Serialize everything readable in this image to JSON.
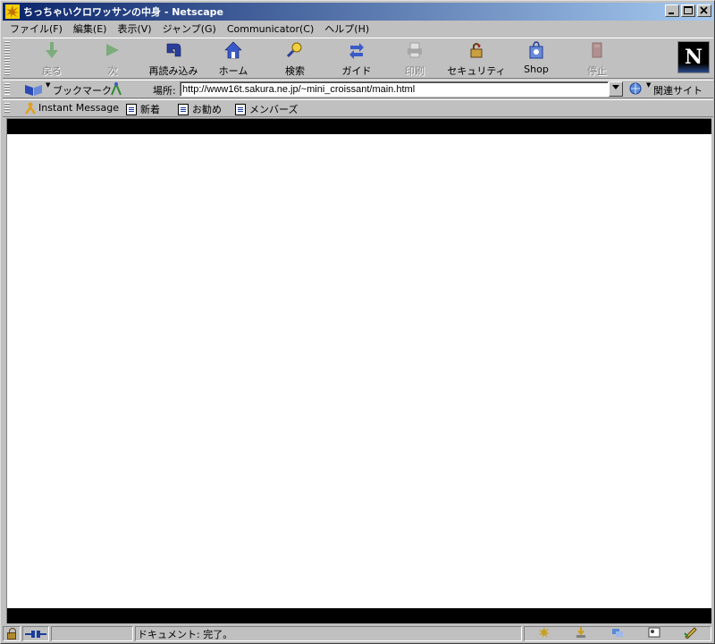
{
  "window": {
    "title": "ちっちゃいクロワッサンの中身 - Netscape",
    "buttons": {
      "minimize": "_",
      "maximize": "□",
      "close": "×"
    }
  },
  "menu": [
    {
      "label": "ファイル(F)"
    },
    {
      "label": "編集(E)"
    },
    {
      "label": "表示(V)"
    },
    {
      "label": "ジャンプ(G)"
    },
    {
      "label": "Communicator(C)"
    },
    {
      "label": "ヘルプ(H)"
    }
  ],
  "nav_toolbar": {
    "back": {
      "label": "戻る",
      "icon": "back-arrow-icon",
      "enabled": false
    },
    "forward": {
      "label": "次",
      "icon": "forward-arrow-icon",
      "enabled": false
    },
    "reload": {
      "label": "再読み込み",
      "icon": "reload-icon",
      "enabled": true
    },
    "home": {
      "label": "ホーム",
      "icon": "home-icon",
      "enabled": true
    },
    "search": {
      "label": "検索",
      "icon": "search-icon",
      "enabled": true
    },
    "guide": {
      "label": "ガイド",
      "icon": "guide-icon",
      "enabled": true
    },
    "print": {
      "label": "印刷",
      "icon": "print-icon",
      "enabled": false
    },
    "security": {
      "label": "セキュリティ",
      "icon": "security-lock-icon",
      "enabled": true
    },
    "shop": {
      "label": "Shop",
      "icon": "shop-bag-icon",
      "enabled": true
    },
    "stop": {
      "label": "停止",
      "icon": "stop-icon",
      "enabled": false
    }
  },
  "location_bar": {
    "bookmarks_label": "ブックマーク",
    "location_label": "場所:",
    "url": "http://www16t.sakura.ne.jp/~mini_croissant/main.html",
    "related_label": "関連サイト"
  },
  "personal_toolbar": {
    "items": [
      {
        "label": "Instant Message"
      },
      {
        "label": "新着"
      },
      {
        "label": "お勧め"
      },
      {
        "label": "メンバーズ"
      }
    ]
  },
  "status_bar": {
    "text": "ドキュメント: 完了。"
  },
  "colors": {
    "titlebar_start": "#0a246a",
    "titlebar_end": "#a6caf0",
    "chrome": "#c0c0c0",
    "content_bg": "#ffffff",
    "frame_band": "#000000"
  }
}
